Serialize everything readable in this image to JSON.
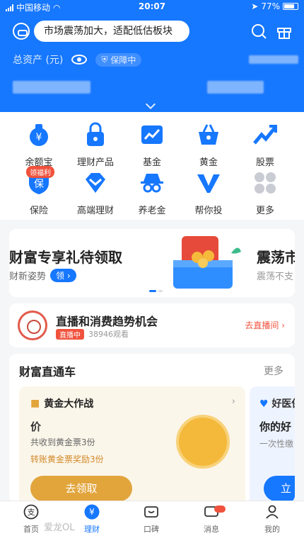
{
  "status_bar": {
    "carrier": "中国移动",
    "time": "20:07",
    "battery": "77%"
  },
  "header": {
    "notice": "市场震荡加大，适配低估板块",
    "total_assets_label": "总资产 (元)",
    "guard_label": "保障中"
  },
  "grid": [
    {
      "label": "余额宝",
      "icon": "yuebao-icon",
      "color": "#1677ff"
    },
    {
      "label": "理财产品",
      "icon": "lock-icon",
      "color": "#1677ff"
    },
    {
      "label": "基金",
      "icon": "chart-icon",
      "color": "#1677ff"
    },
    {
      "label": "黄金",
      "icon": "basket-icon",
      "color": "#1677ff"
    },
    {
      "label": "股票",
      "icon": "trend-icon",
      "color": "#1677ff"
    },
    {
      "label": "保险",
      "icon": "shield-icon",
      "color": "#1677ff",
      "badge": "领福利"
    },
    {
      "label": "高端理财",
      "icon": "diamond-icon",
      "color": "#1677ff"
    },
    {
      "label": "养老金",
      "icon": "spy-icon",
      "color": "#1677ff"
    },
    {
      "label": "帮你投",
      "icon": "v-icon",
      "color": "#1677ff"
    },
    {
      "label": "更多",
      "icon": "more-icon",
      "color": "#c9ccd2"
    }
  ],
  "banner": {
    "left_title": "财富专享礼待领取",
    "left_sub": "财新姿势",
    "left_pill": "领",
    "right_title": "震荡市",
    "right_sub": "震荡不支"
  },
  "live": {
    "title": "直播和消费趋势机会",
    "live_tag": "直播中",
    "viewers": "38946观看",
    "cta": "去直播间 ›"
  },
  "wealth": {
    "title": "财富直通车",
    "more": "更多",
    "gold": {
      "header": "黄金大作战",
      "line1": "价",
      "line2": "共收到黄金票3份",
      "line3": "转账黄金票奖励3份",
      "button": "去领取"
    },
    "health": {
      "header": "好医保",
      "line1": "你的好",
      "line2": "一次性缴",
      "button": "立"
    }
  },
  "tabbar": [
    {
      "label": "首页",
      "icon": "alipay-icon"
    },
    {
      "label": "理财",
      "icon": "yuan-icon",
      "active": true
    },
    {
      "label": "口碑",
      "icon": "koubei-icon"
    },
    {
      "label": "消息",
      "icon": "message-icon"
    },
    {
      "label": "我的",
      "icon": "user-icon"
    }
  ],
  "watermark": "爱龙OL",
  "colors": {
    "brand": "#1677ff",
    "alert": "#f0523d",
    "gold": "#e2a53c"
  }
}
